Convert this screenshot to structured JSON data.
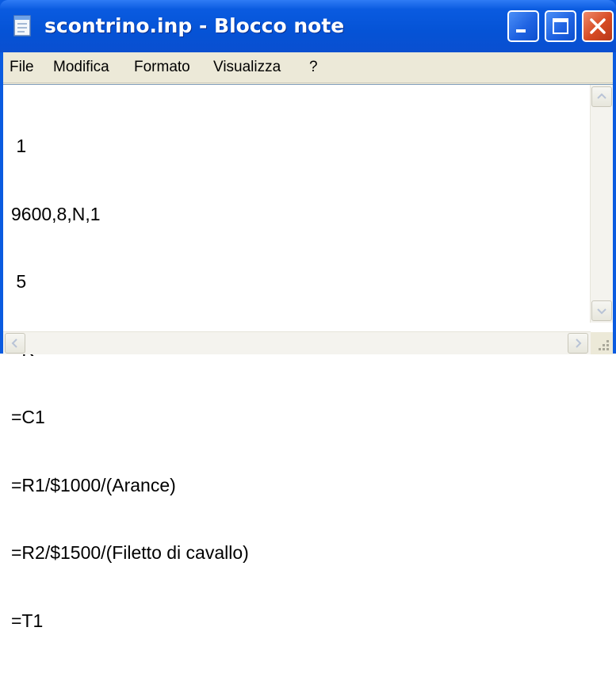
{
  "window": {
    "title": "scontrino.inp - Blocco note"
  },
  "menu": {
    "items": [
      "File",
      "Modifica",
      "Formato",
      "Visualizza",
      "?"
    ]
  },
  "document": {
    "lines": [
      " 1",
      "9600,8,N,1",
      " 5",
      "=K",
      "=C1",
      "=R1/$1000/(Arance)",
      "=R2/$1500/(Filetto di cavallo)",
      "=T1"
    ]
  },
  "icons": {
    "app": "notepad-icon",
    "minimize": "minimize-icon",
    "maximize": "maximize-icon",
    "close": "close-icon",
    "scroll_up": "chevron-up-icon",
    "scroll_down": "chevron-down-icon",
    "scroll_left": "chevron-left-icon",
    "scroll_right": "chevron-right-icon",
    "resize": "resize-grip-icon"
  },
  "colors": {
    "titlebar": "#0a5be0",
    "close_button": "#d64a22",
    "menubar": "#ece9d8",
    "editor_bg": "#ffffff"
  }
}
